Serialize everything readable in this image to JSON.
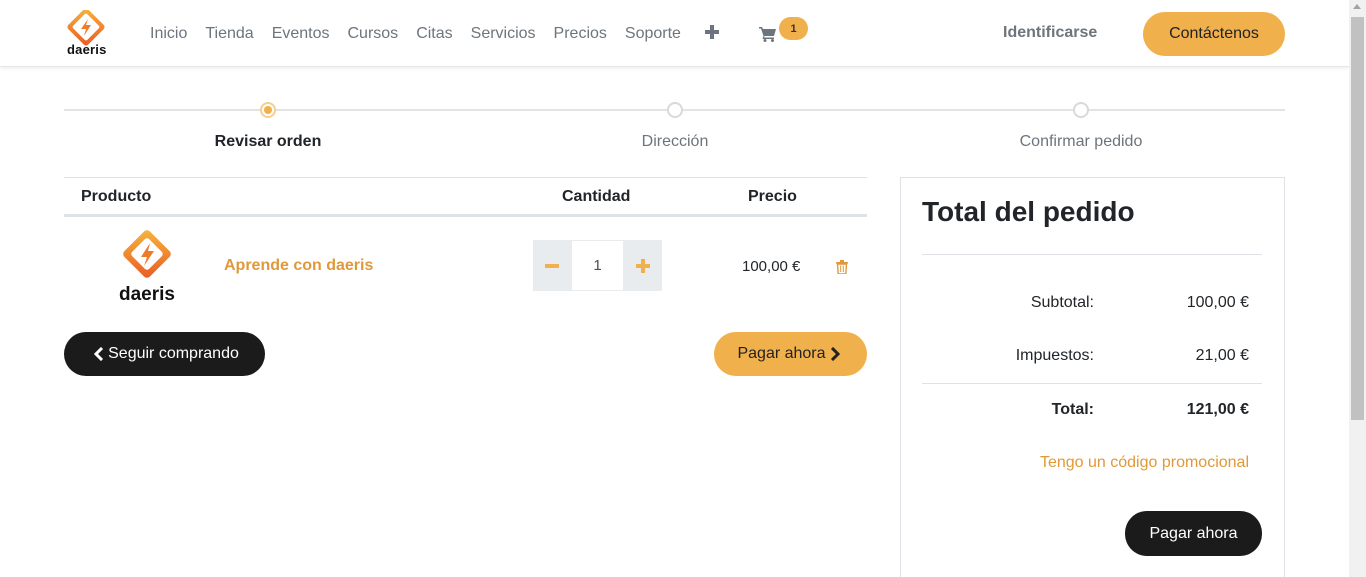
{
  "brand": {
    "name": "daeris",
    "accent": "#f0b04b",
    "accent_text": "#e0993a"
  },
  "nav": {
    "items": [
      "Inicio",
      "Tienda",
      "Eventos",
      "Cursos",
      "Citas",
      "Servicios",
      "Precios",
      "Soporte"
    ],
    "more_icon": "plus-icon",
    "cart_icon": "cart-icon",
    "cart_count": "1",
    "login": "Identificarse",
    "contact": "Contáctenos"
  },
  "steps": [
    {
      "label": "Revisar orden",
      "active": true
    },
    {
      "label": "Dirección",
      "active": false
    },
    {
      "label": "Confirmar pedido",
      "active": false
    }
  ],
  "cart": {
    "headers": {
      "product": "Producto",
      "quantity": "Cantidad",
      "price": "Precio"
    },
    "items": [
      {
        "logo_text": "daeris",
        "name": "Aprende con daeris",
        "quantity": "1",
        "price": "100,00 €"
      }
    ],
    "keep_shopping": "Seguir comprando",
    "pay_now": "Pagar ahora"
  },
  "summary": {
    "title": "Total del pedido",
    "subtotal_label": "Subtotal:",
    "subtotal": "100,00 €",
    "taxes_label": "Impuestos:",
    "taxes": "21,00 €",
    "total_label": "Total:",
    "total": "121,00 €",
    "promo": "Tengo un código promocional",
    "pay_now": "Pagar ahora"
  }
}
